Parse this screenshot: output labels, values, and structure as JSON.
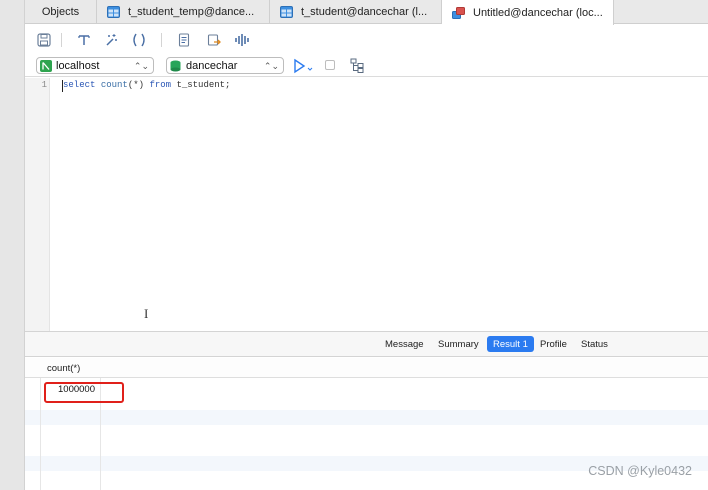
{
  "tabs": [
    {
      "label": "Objects",
      "icon": "none",
      "active": false
    },
    {
      "label": "t_student_temp@dance...",
      "icon": "table-icon",
      "active": false
    },
    {
      "label": "t_student@dancechar (l...",
      "icon": "table-icon",
      "active": false
    },
    {
      "label": "Untitled@dancechar (loc...",
      "icon": "query-icon",
      "active": true
    }
  ],
  "toolbar": {
    "icons": [
      "save-icon",
      "format-sql-icon",
      "beautify-icon",
      "parentheses-icon",
      "snippet-icon",
      "export-icon",
      "audio-wave-icon"
    ]
  },
  "connection": {
    "host": "localhost",
    "database": "dancechar"
  },
  "editor": {
    "line_number": "1",
    "code_parts": {
      "kw_select": "select",
      "fn_count": "count",
      "args": "(*)",
      "kw_from": "from",
      "table": "t_student;"
    }
  },
  "result_tabs": [
    {
      "label": "Message",
      "active": false
    },
    {
      "label": "Summary",
      "active": false
    },
    {
      "label": "Result 1",
      "active": true
    },
    {
      "label": "Profile",
      "active": false
    },
    {
      "label": "Status",
      "active": false
    }
  ],
  "grid": {
    "columns": [
      "count(*)"
    ],
    "rows": [
      [
        "1000000"
      ]
    ]
  },
  "watermark": "CSDN @Kyle0432",
  "colors": {
    "accent": "#2b7bf0",
    "highlight": "#e0201a",
    "keyword": "#2a56b5"
  }
}
